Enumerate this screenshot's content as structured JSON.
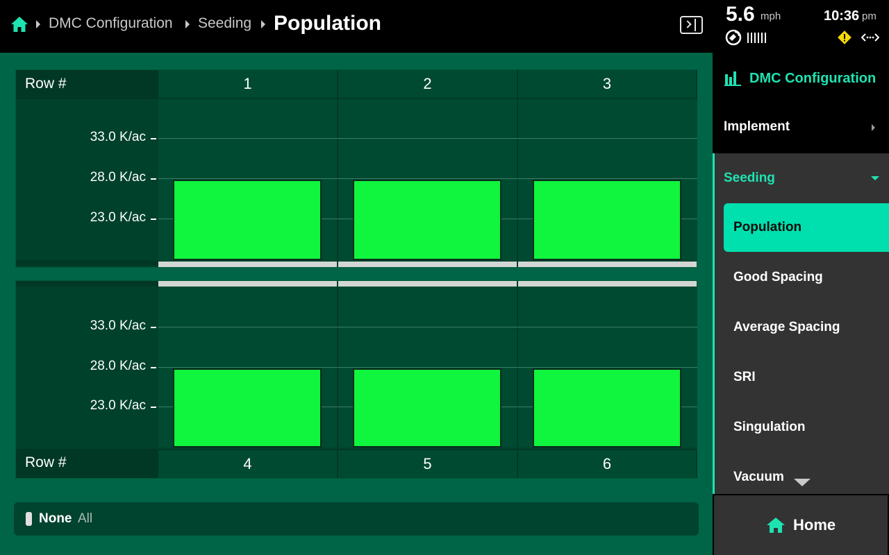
{
  "breadcrumb": {
    "home_icon": "home-icon",
    "items": [
      "DMC Configuration",
      "Seeding"
    ],
    "current": "Population"
  },
  "status": {
    "speed": "5.6",
    "speed_unit": "mph",
    "time": "10:36",
    "ampm": "pm",
    "icons": [
      "gps-icon",
      "signal-bars",
      "warning-icon",
      "connection-icon"
    ],
    "warning_color": "#f5d90a"
  },
  "grid": {
    "row_header_label": "Row #",
    "tick_labels": [
      "33.0 K/ac",
      "28.0 K/ac",
      "23.0 K/ac"
    ],
    "top_rows": [
      "1",
      "2",
      "3"
    ],
    "bottom_rows": [
      "4",
      "5",
      "6"
    ],
    "bar_color": "#10f53e"
  },
  "chart_data": [
    {
      "type": "bar",
      "categories": [
        "1",
        "2",
        "3"
      ],
      "values": [
        28.0,
        28.0,
        28.0
      ],
      "xlabel": "Row #",
      "ylabel": "",
      "y_ticks": [
        23.0,
        28.0,
        33.0
      ],
      "unit": "K/ac",
      "grid": true
    },
    {
      "type": "bar",
      "categories": [
        "4",
        "5",
        "6"
      ],
      "values": [
        28.0,
        28.0,
        28.0
      ],
      "xlabel": "Row #",
      "ylabel": "",
      "y_ticks": [
        23.0,
        28.0,
        33.0
      ],
      "unit": "K/ac",
      "grid": true
    }
  ],
  "filter": {
    "selected": "None",
    "option": "All"
  },
  "sidebar": {
    "title": "DMC Configuration",
    "title_icon": "bar-chart-icon",
    "implement_label": "Implement",
    "seeding_label": "Seeding",
    "seeding_items": [
      "Population",
      "Good Spacing",
      "Average Spacing",
      "SRI",
      "Singulation",
      "Vacuum"
    ],
    "active_item": "Population",
    "accent_color": "#1ee3b1"
  },
  "home_button": {
    "label": "Home"
  }
}
